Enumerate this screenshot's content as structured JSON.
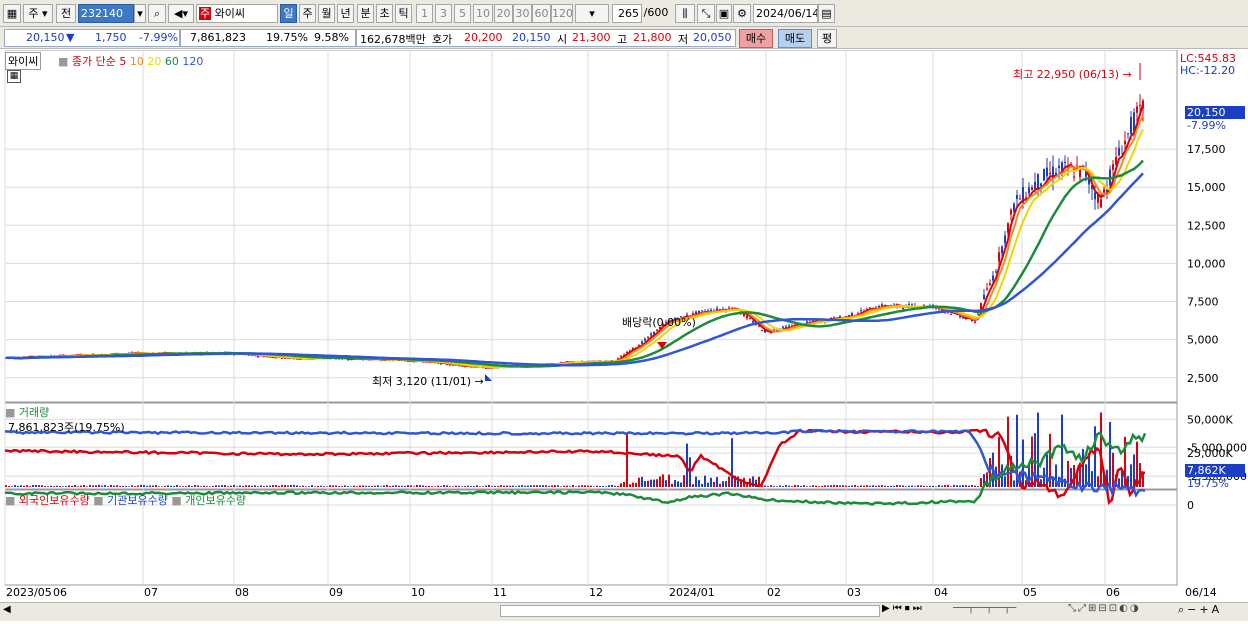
{
  "toolbar": {
    "market": "주",
    "prefix": "전",
    "code": "232140",
    "stock_name": "와이씨",
    "periods": [
      "일",
      "주",
      "월",
      "년",
      "분",
      "초",
      "틱"
    ],
    "active_period": "일",
    "intervals": [
      "1",
      "3",
      "5",
      "10",
      "20",
      "30",
      "60",
      "120"
    ],
    "count": "265",
    "count_max": "/600",
    "date": "2024/06/14",
    "icons": [
      "layout-icon",
      "search-icon",
      "sound-icon",
      "candle-icon",
      "crosshair-icon",
      "save-icon",
      "gear-icon",
      "calendar-icon"
    ]
  },
  "quote": {
    "price": "20,150",
    "change_arrow": "▼",
    "change": "1,750",
    "change_pct": "-7.99%",
    "volume": "7,861,823",
    "volume_ratio": "19.75%",
    "turnover": "9.58%",
    "amount": "162,678백만",
    "bid_label": "호가",
    "bid": "20,200",
    "ask": "20,150",
    "open_label": "시",
    "open": "21,300",
    "high_label": "고",
    "high": "21,800",
    "low_label": "저",
    "low": "20,050",
    "buy": "매수",
    "sell": "매도",
    "even": "평"
  },
  "price_panel": {
    "name": "와이씨",
    "ma_label": "종가 단순",
    "ma_periods": [
      {
        "p": "5",
        "color": "#d8000c"
      },
      {
        "p": "10",
        "color": "#f08a1e"
      },
      {
        "p": "20",
        "color": "#f2d400"
      },
      {
        "p": "60",
        "color": "#1e8a3c"
      },
      {
        "p": "120",
        "color": "#2f56d6"
      }
    ],
    "lc": "LC:545.83",
    "hc": "HC:-12.20",
    "y_ticks": [
      "17,500",
      "15,000",
      "12,500",
      "10,000",
      "7,500",
      "5,000",
      "2,500"
    ],
    "current_price": "20,150",
    "current_pct": "-7.99%",
    "high_note": "최고 22,950 (06/13) →",
    "low_note": "최저 3,120 (11/01) →",
    "dividend_note": "배당락(0.00%)"
  },
  "volume_panel": {
    "name": "거래량",
    "value": "7,861,823주(19.75%)",
    "y_ticks": [
      "50,000K",
      "25,000K"
    ],
    "current": "7,862K",
    "current_pct": "19.75%"
  },
  "holder_panel": {
    "series": [
      {
        "name": "외국인보유수량",
        "color": "#d8000c"
      },
      {
        "name": "기관보유수량",
        "color": "#2f56d6"
      },
      {
        "name": "개인보유수량",
        "color": "#1e8a3c"
      }
    ],
    "y_ticks": [
      "0",
      "-2,500,000",
      "-5,000,000"
    ]
  },
  "x_axis": {
    "labels": [
      "2023/05",
      "06",
      "07",
      "08",
      "09",
      "10",
      "11",
      "12",
      "2024/01",
      "02",
      "03",
      "04",
      "05",
      "06"
    ],
    "right": "06/14"
  },
  "chart_data": {
    "type": "candlestick",
    "x": [
      "2023/05",
      "06",
      "07",
      "08",
      "09",
      "10",
      "11",
      "12",
      "2024/01",
      "02",
      "03",
      "04",
      "05",
      "06"
    ],
    "close": [
      3800,
      4000,
      4200,
      4050,
      3800,
      3650,
      3200,
      3500,
      6800,
      5600,
      7200,
      7000,
      15800,
      20150
    ],
    "ylim": [
      1500,
      24000
    ]
  }
}
